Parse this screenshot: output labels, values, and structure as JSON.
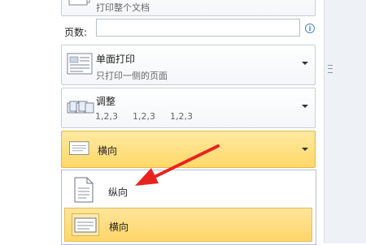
{
  "print_panel": {
    "print_all": {
      "desc": "打印整个文档"
    },
    "pages": {
      "label": "页数:",
      "value": "",
      "info_icon": "info-icon"
    },
    "sides": {
      "title": "单面打印",
      "desc": "只打印一侧的页面"
    },
    "collate": {
      "title": "调整",
      "seq1": "1,2,3",
      "seq2": "1,2,3",
      "seq3": "1,2,3"
    },
    "orientation": {
      "selected": "横向",
      "options": [
        {
          "label": "纵向",
          "icon": "portrait-page-icon"
        },
        {
          "label": "横向",
          "icon": "landscape-page-icon",
          "selected": true
        }
      ]
    }
  },
  "annotation": {
    "arrow_color": "#e8231f"
  }
}
